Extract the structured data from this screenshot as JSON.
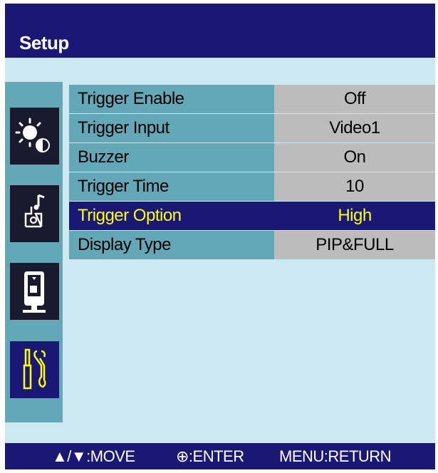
{
  "title": "Setup",
  "sidebar": {
    "items": [
      {
        "icon": "brightness-contrast-icon",
        "active": false
      },
      {
        "icon": "audio-icon",
        "active": false
      },
      {
        "icon": "pip-display-icon",
        "active": false
      },
      {
        "icon": "tools-setup-icon",
        "active": true
      }
    ]
  },
  "menu": {
    "rows": [
      {
        "label": "Trigger Enable",
        "value": "Off"
      },
      {
        "label": "Trigger Input",
        "value": "Video1"
      },
      {
        "label": "Buzzer",
        "value": "On"
      },
      {
        "label": "Trigger Time",
        "value": "10"
      },
      {
        "label": "Trigger Option",
        "value": "High",
        "selected": true
      },
      {
        "label": "Display Type",
        "value": "PIP&FULL"
      }
    ]
  },
  "help": {
    "move": "▲/▼:MOVE",
    "enter": "⊕:ENTER",
    "return": "MENU:RETURN"
  },
  "colors": {
    "background": "#cce9f1",
    "title_bar": "#1a1875",
    "sidebar": "#64a7b7",
    "value_cell": "#bcbcbc",
    "selected_text": "#ffff00"
  }
}
